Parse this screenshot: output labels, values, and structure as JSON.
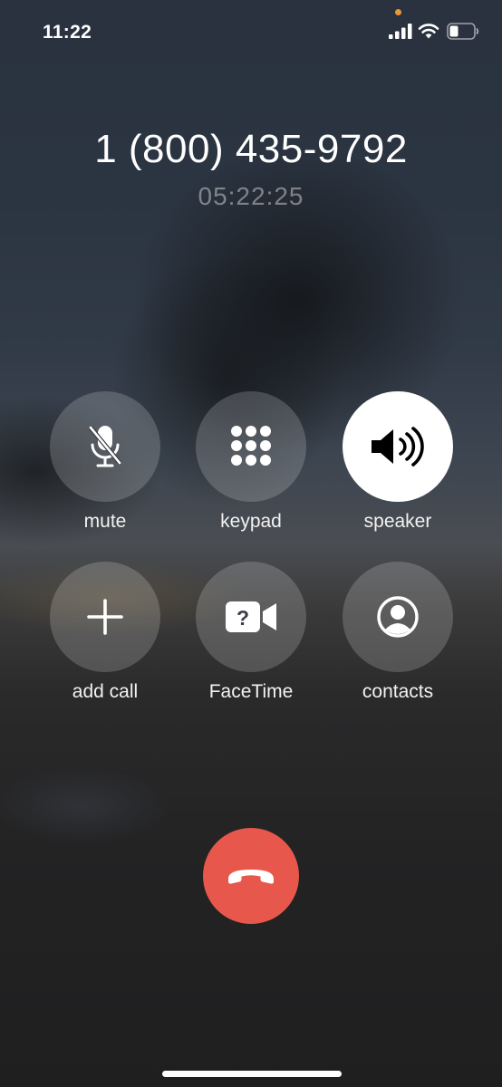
{
  "status_bar": {
    "time": "11:22",
    "icons": [
      "orange-dot",
      "cellular-signal-icon",
      "wifi-icon",
      "battery-icon"
    ],
    "privacy_dot_color": "#e8963a"
  },
  "call": {
    "number": "1 (800) 435-9792",
    "duration": "05:22:25"
  },
  "controls": {
    "mute": {
      "label": "mute",
      "icon": "mic-slash-icon",
      "active": false
    },
    "keypad": {
      "label": "keypad",
      "icon": "keypad-grid-icon",
      "active": false
    },
    "speaker": {
      "label": "speaker",
      "icon": "speaker-wave-icon",
      "active": true
    },
    "add_call": {
      "label": "add call",
      "icon": "plus-icon",
      "active": false
    },
    "facetime": {
      "label": "FaceTime",
      "icon": "video-question-icon",
      "active": false
    },
    "contacts": {
      "label": "contacts",
      "icon": "person-circle-icon",
      "active": false
    }
  },
  "end_call": {
    "icon": "phone-hangup-icon",
    "color": "#e8574c"
  }
}
